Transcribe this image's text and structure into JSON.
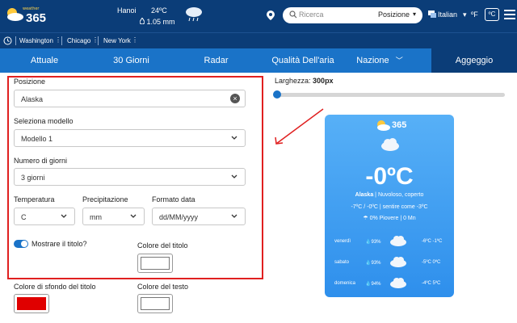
{
  "header": {
    "brand_small": "weather",
    "brand_num": "365",
    "city": "Hanoi",
    "temp": "24ºC",
    "rain": "1.05 mm",
    "search_placeholder": "Ricerca",
    "search_select": "Posizione",
    "language": "Italian",
    "unit_f": "ºF",
    "unit_c": "ºC"
  },
  "cities": [
    "Washington",
    "Chicago",
    "New York"
  ],
  "nav": {
    "tabs": [
      "Attuale",
      "30 Giorni",
      "Radar",
      "Qualità Dell'aria",
      "Nazione",
      "Aggeggio"
    ],
    "active": "Aggeggio"
  },
  "form": {
    "position_label": "Posizione",
    "position_value": "Alaska",
    "model_label": "Seleziona modello",
    "model_value": "Modello 1",
    "days_label": "Numero di giorni",
    "days_value": "3 giorni",
    "temp_label": "Temperatura",
    "temp_value": "C",
    "precip_label": "Precipitazione",
    "precip_value": "mm",
    "date_label": "Formato data",
    "date_value": "dd/MM/yyyy",
    "show_title_label": "Mostrare il titolo?",
    "title_color_label": "Colore del titolo",
    "title_bg_label": "Colore di sfondo del titolo",
    "text_color_label": "Colore del testo",
    "title_bg_color": "#e00000"
  },
  "preview": {
    "width_label": "Larghezza:",
    "width_value": "300px",
    "widget_num": "365",
    "temp": "-0ºC",
    "location": "Alaska",
    "condition": "Nuvoloso, coperto",
    "feels": "-7ºC / -0ºC | sentire come -3ºC",
    "rain": "0% Piovere | 0 Mn",
    "forecast": [
      {
        "day": "venerdì",
        "pct": "93%",
        "range": "-6ºC -1ºC"
      },
      {
        "day": "sabato",
        "pct": "93%",
        "range": "-5ºC 0ºC"
      },
      {
        "day": "domenica",
        "pct": "94%",
        "range": "-4ºC 5ºC"
      }
    ]
  },
  "colors": {
    "accent": "#1a73c8",
    "header": "#0b3d78",
    "highlight_border": "#e02020",
    "widget": "#3a9bf0"
  }
}
